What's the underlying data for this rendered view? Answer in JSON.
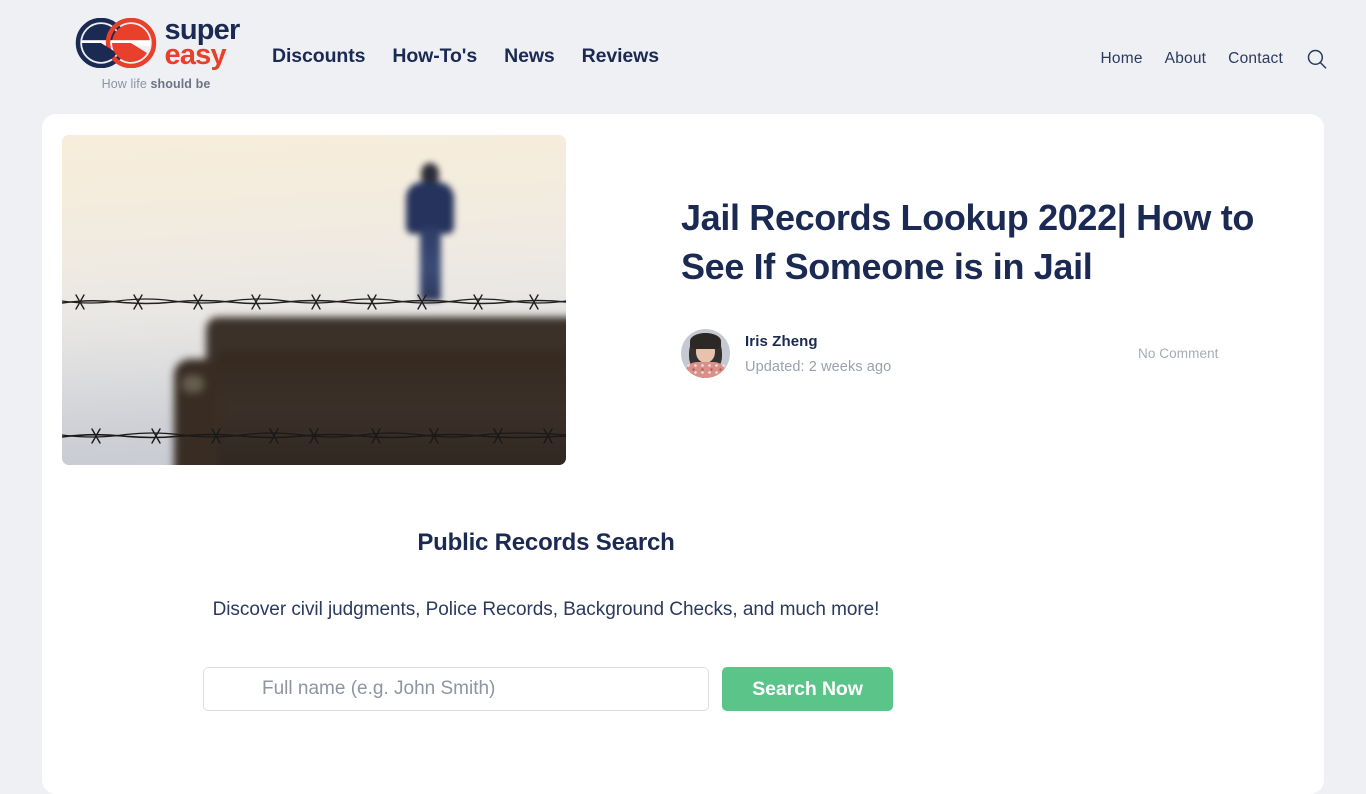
{
  "brand": {
    "name_first": "super",
    "name_second": "easy",
    "tagline_light": "How life ",
    "tagline_bold": "should be",
    "logo_icon": "double-e-logo-icon",
    "logo_navy": "#1b2a53",
    "logo_red": "#e8402b"
  },
  "header": {
    "main_nav": [
      {
        "label": "Discounts",
        "name": "nav-discounts"
      },
      {
        "label": "How-To's",
        "name": "nav-how-tos"
      },
      {
        "label": "News",
        "name": "nav-news"
      },
      {
        "label": "Reviews",
        "name": "nav-reviews"
      }
    ],
    "util_nav": [
      {
        "label": "Home",
        "name": "nav-home"
      },
      {
        "label": "About",
        "name": "nav-about"
      },
      {
        "label": "Contact",
        "name": "nav-contact"
      }
    ],
    "search_icon": "search-icon",
    "background": "#eff0f4"
  },
  "article": {
    "title": "Jail Records Lookup 2022| How to See If Someone is in Jail",
    "author": "Iris Zheng",
    "updated": "Updated: 2 weeks ago",
    "comments": "No Comment",
    "hero_image_alt": "blurred silhouette of a person standing behind barbed wire",
    "title_color": "#1b2a53"
  },
  "records_search": {
    "heading": "Public Records Search",
    "subtitle": "Discover civil judgments, Police Records, Background Checks, and much more!",
    "input_placeholder": "Full name (e.g. John Smith)",
    "input_value": "",
    "button_label": "Search Now",
    "button_color": "#5ac489"
  }
}
